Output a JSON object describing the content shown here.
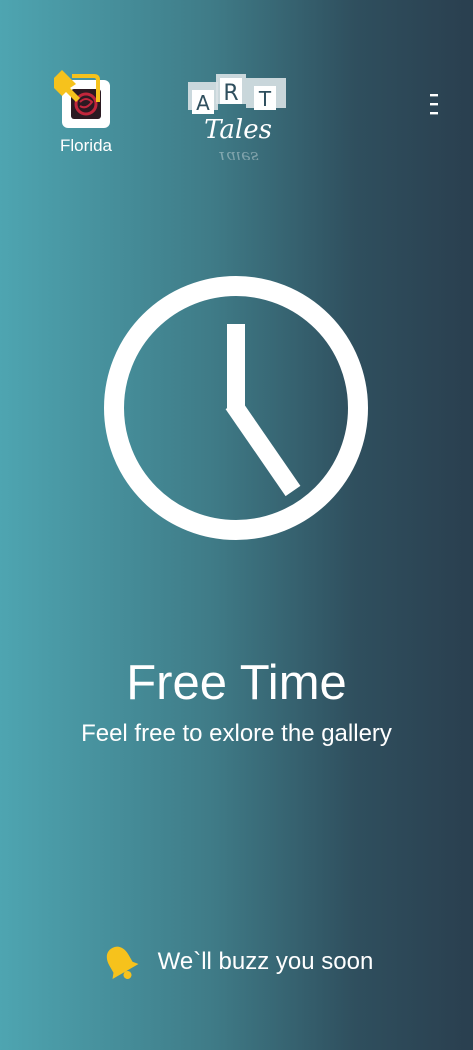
{
  "header": {
    "venue_label": "Florida",
    "logo_letters": [
      "A",
      "R",
      "T"
    ],
    "logo_word": "Tales",
    "menu_icon": "more-vertical-icon"
  },
  "main": {
    "status_icon": "clock-icon",
    "title": "Free Time",
    "subtitle": "Feel free to exlore the gallery"
  },
  "footer": {
    "icon": "bell-icon",
    "text": "We`ll buzz you soon"
  },
  "colors": {
    "accent": "#f6c21c",
    "gradient_start": "#4ea5b1",
    "gradient_end": "#2a3f4f"
  }
}
